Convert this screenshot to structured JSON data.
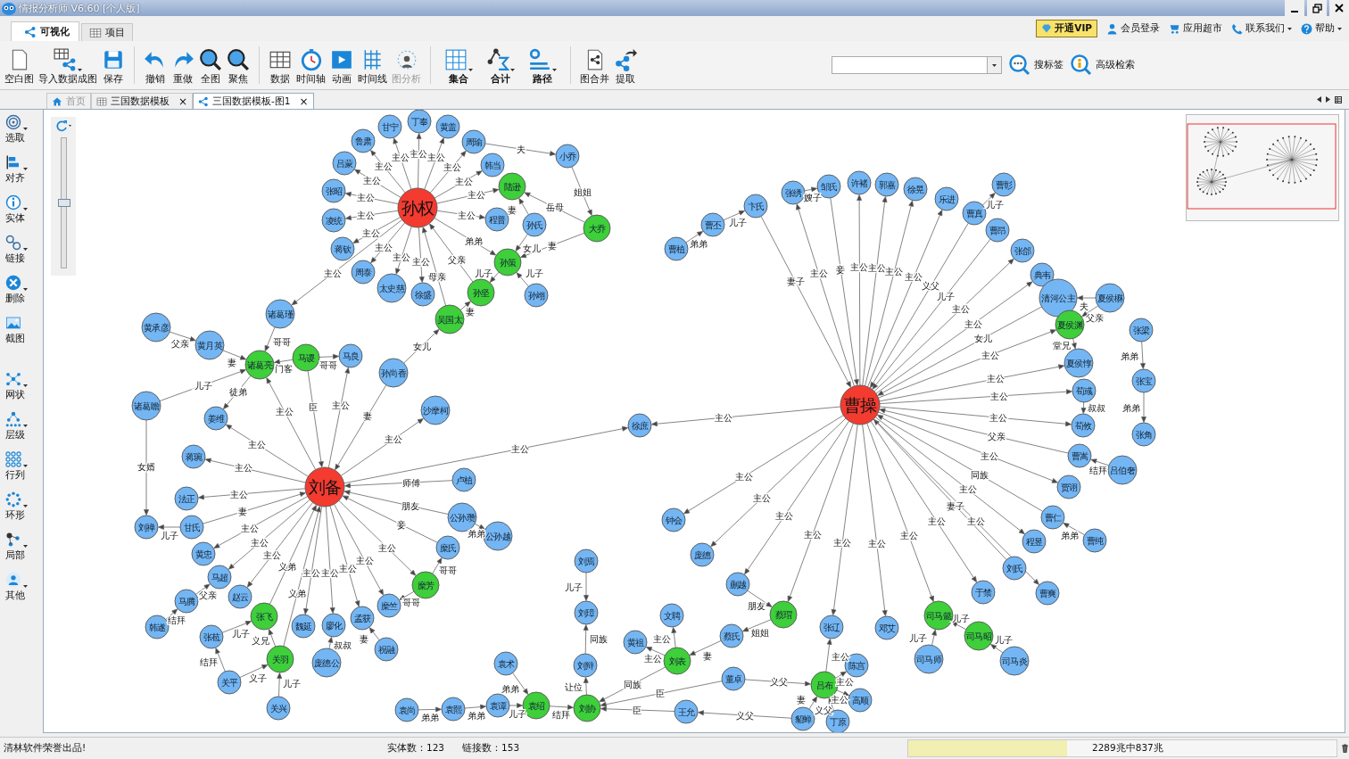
{
  "window": {
    "title": "情报分析师 V6.60 [个人版]"
  },
  "view_tabs": [
    {
      "label": "可视化",
      "selected": true
    },
    {
      "label": "项目",
      "selected": false
    }
  ],
  "header_links": [
    {
      "label": "开通VIP",
      "kind": "vip",
      "menu": false
    },
    {
      "label": "会员登录",
      "kind": "link",
      "menu": false
    },
    {
      "label": "应用超市",
      "kind": "link",
      "menu": false
    },
    {
      "label": "联系我们",
      "kind": "link",
      "menu": true
    },
    {
      "label": "帮助",
      "kind": "link",
      "menu": true
    }
  ],
  "toolbar": {
    "groups": [
      {
        "items": [
          {
            "label": "空白图",
            "disabled": false,
            "menu": false
          },
          {
            "label": "导入数据成图",
            "disabled": false,
            "menu": true
          },
          {
            "label": "保存",
            "disabled": false,
            "menu": false
          }
        ]
      },
      {
        "items": [
          {
            "label": "撤销",
            "disabled": false,
            "menu": false
          },
          {
            "label": "重做",
            "disabled": false,
            "menu": false
          },
          {
            "label": "全图",
            "disabled": false,
            "menu": false
          },
          {
            "label": "聚焦",
            "disabled": false,
            "menu": false
          }
        ]
      },
      {
        "items": [
          {
            "label": "数据",
            "disabled": false,
            "menu": false
          },
          {
            "label": "时间轴",
            "disabled": false,
            "menu": false
          },
          {
            "label": "动画",
            "disabled": false,
            "menu": false
          },
          {
            "label": "时间线",
            "disabled": false,
            "menu": false
          },
          {
            "label": "图分析",
            "disabled": true,
            "menu": false
          }
        ]
      },
      {
        "items": [
          {
            "label": "集合",
            "disabled": false,
            "menu": true
          },
          {
            "label": "合计",
            "disabled": false,
            "menu": true
          },
          {
            "label": "路径",
            "disabled": false,
            "menu": true
          }
        ]
      },
      {
        "items": [
          {
            "label": "图合并",
            "disabled": false,
            "menu": false
          },
          {
            "label": "提取",
            "disabled": false,
            "menu": false
          }
        ]
      }
    ],
    "search_buttons": [
      {
        "label": "搜标签"
      },
      {
        "label": "高级检索"
      }
    ]
  },
  "doc_tabs": [
    {
      "label": "首页",
      "selected": false,
      "disabled": true
    },
    {
      "label": "三国数据模板",
      "selected": false,
      "disabled": false,
      "close": "×"
    },
    {
      "label": "三国数据模板-图1",
      "selected": true,
      "disabled": false,
      "close": "×"
    }
  ],
  "side_tools": {
    "groups": [
      {
        "items": [
          {
            "label": "选取",
            "menu": true
          },
          {
            "label": "对齐",
            "menu": true
          },
          {
            "label": "实体",
            "menu": true
          },
          {
            "label": "链接",
            "menu": true
          },
          {
            "label": "删除",
            "menu": true
          },
          {
            "label": "截图",
            "menu": false
          }
        ]
      },
      {
        "items": [
          {
            "label": "网状",
            "menu": true
          },
          {
            "label": "层级",
            "menu": true
          },
          {
            "label": "行列",
            "menu": true
          },
          {
            "label": "环形",
            "menu": true
          },
          {
            "label": "局部",
            "menu": true
          },
          {
            "label": "其他",
            "menu": true
          }
        ]
      }
    ]
  },
  "graph": {
    "zoom_slider": {
      "level": 0.5
    },
    "nodes": [
      {
        "label": "甘宁",
        "kind": "person"
      },
      {
        "label": "丁奉",
        "kind": "person"
      },
      {
        "label": "黄盖",
        "kind": "person"
      },
      {
        "label": "鲁肃",
        "kind": "person"
      },
      {
        "label": "周瑜",
        "kind": "person"
      },
      {
        "label": "小乔",
        "kind": "person"
      },
      {
        "label": "吕蒙",
        "kind": "person"
      },
      {
        "label": "韩当",
        "kind": "person"
      },
      {
        "label": "张昭",
        "kind": "person"
      },
      {
        "label": "陆逊",
        "kind": "key"
      },
      {
        "label": "张绣",
        "kind": "person"
      },
      {
        "label": "邹氏",
        "kind": "person"
      },
      {
        "label": "许褚",
        "kind": "person"
      },
      {
        "label": "郭嘉",
        "kind": "person"
      },
      {
        "label": "徐晃",
        "kind": "person"
      },
      {
        "label": "乐进",
        "kind": "person"
      },
      {
        "label": "曹彰",
        "kind": "person"
      },
      {
        "label": "凌统",
        "kind": "person"
      },
      {
        "label": "孙权",
        "kind": "hub"
      },
      {
        "label": "程普",
        "kind": "person"
      },
      {
        "label": "卞氏",
        "kind": "person"
      },
      {
        "label": "曹真",
        "kind": "person"
      },
      {
        "label": "孙氏",
        "kind": "person"
      },
      {
        "label": "大乔",
        "kind": "key"
      },
      {
        "label": "曹丕",
        "kind": "person"
      },
      {
        "label": "曹昂",
        "kind": "person"
      },
      {
        "label": "蒋钦",
        "kind": "person"
      },
      {
        "label": "孙策",
        "kind": "key"
      },
      {
        "label": "曹植",
        "kind": "person"
      },
      {
        "label": "张郃",
        "kind": "person"
      },
      {
        "label": "周泰",
        "kind": "person"
      },
      {
        "label": "太史慈",
        "kind": "person"
      },
      {
        "label": "典韦",
        "kind": "person"
      },
      {
        "label": "徐盛",
        "kind": "person"
      },
      {
        "label": "孙坚",
        "kind": "key"
      },
      {
        "label": "孙翊",
        "kind": "person"
      },
      {
        "label": "清河公主",
        "kind": "person"
      },
      {
        "label": "夏侯楙",
        "kind": "person"
      },
      {
        "label": "黄承彦",
        "kind": "person"
      },
      {
        "label": "诸葛瑾",
        "kind": "person"
      },
      {
        "label": "吴国太",
        "kind": "key"
      },
      {
        "label": "夏侯渊",
        "kind": "key"
      },
      {
        "label": "张梁",
        "kind": "person"
      },
      {
        "label": "黄月英",
        "kind": "person"
      },
      {
        "label": "马谡",
        "kind": "key"
      },
      {
        "label": "马良",
        "kind": "person"
      },
      {
        "label": "诸葛亮",
        "kind": "key"
      },
      {
        "label": "孙尚香",
        "kind": "person"
      },
      {
        "label": "夏侯惇",
        "kind": "person"
      },
      {
        "label": "荀彧",
        "kind": "person"
      },
      {
        "label": "张宝",
        "kind": "person"
      },
      {
        "label": "诸葛瞻",
        "kind": "person"
      },
      {
        "label": "姜维",
        "kind": "person"
      },
      {
        "label": "沙摩柯",
        "kind": "person"
      },
      {
        "label": "曹操",
        "kind": "hub"
      },
      {
        "label": "徐庶",
        "kind": "person"
      },
      {
        "label": "荀攸",
        "kind": "person"
      },
      {
        "label": "张角",
        "kind": "person"
      },
      {
        "label": "蒋琬",
        "kind": "person"
      },
      {
        "label": "曹嵩",
        "kind": "person"
      },
      {
        "label": "吕伯奢",
        "kind": "person"
      },
      {
        "label": "刘备",
        "kind": "hub"
      },
      {
        "label": "卢植",
        "kind": "person"
      },
      {
        "label": "贾诩",
        "kind": "person"
      },
      {
        "label": "法正",
        "kind": "person"
      },
      {
        "label": "刘禅",
        "kind": "person"
      },
      {
        "label": "甘氏",
        "kind": "person"
      },
      {
        "label": "公孙瓒",
        "kind": "person"
      },
      {
        "label": "钟会",
        "kind": "person"
      },
      {
        "label": "曹仁",
        "kind": "person"
      },
      {
        "label": "糜氏",
        "kind": "person"
      },
      {
        "label": "公孙越",
        "kind": "person"
      },
      {
        "label": "程昱",
        "kind": "person"
      },
      {
        "label": "曹纯",
        "kind": "person"
      },
      {
        "label": "黄忠",
        "kind": "person"
      },
      {
        "label": "刘焉",
        "kind": "person"
      },
      {
        "label": "庞德",
        "kind": "person"
      },
      {
        "label": "刘氏",
        "kind": "person"
      },
      {
        "label": "马超",
        "kind": "person"
      },
      {
        "label": "糜芳",
        "kind": "key"
      },
      {
        "label": "蒯越",
        "kind": "person"
      },
      {
        "label": "于禁",
        "kind": "person"
      },
      {
        "label": "曹爽",
        "kind": "person"
      },
      {
        "label": "马腾",
        "kind": "person"
      },
      {
        "label": "赵云",
        "kind": "person"
      },
      {
        "label": "糜竺",
        "kind": "person"
      },
      {
        "label": "刘璋",
        "kind": "person"
      },
      {
        "label": "韩遂",
        "kind": "person"
      },
      {
        "label": "张飞",
        "kind": "key"
      },
      {
        "label": "魏延",
        "kind": "person"
      },
      {
        "label": "廖化",
        "kind": "person"
      },
      {
        "label": "孟获",
        "kind": "person"
      },
      {
        "label": "文聘",
        "kind": "person"
      },
      {
        "label": "蔡瑁",
        "kind": "key"
      },
      {
        "label": "张辽",
        "kind": "person"
      },
      {
        "label": "邓艾",
        "kind": "person"
      },
      {
        "label": "司马懿",
        "kind": "key"
      },
      {
        "label": "张苞",
        "kind": "person"
      },
      {
        "label": "祝融",
        "kind": "person"
      },
      {
        "label": "黄祖",
        "kind": "person"
      },
      {
        "label": "蔡氏",
        "kind": "person"
      },
      {
        "label": "司马昭",
        "kind": "key"
      },
      {
        "label": "关羽",
        "kind": "key"
      },
      {
        "label": "庞德公",
        "kind": "person"
      },
      {
        "label": "袁术",
        "kind": "person"
      },
      {
        "label": "刘辩",
        "kind": "person"
      },
      {
        "label": "刘表",
        "kind": "key"
      },
      {
        "label": "陈宫",
        "kind": "person"
      },
      {
        "label": "司马师",
        "kind": "person"
      },
      {
        "label": "司马炎",
        "kind": "person"
      },
      {
        "label": "关平",
        "kind": "person"
      },
      {
        "label": "董卓",
        "kind": "person"
      },
      {
        "label": "吕布",
        "kind": "key"
      },
      {
        "label": "关兴",
        "kind": "person"
      },
      {
        "label": "袁尚",
        "kind": "person"
      },
      {
        "label": "袁熙",
        "kind": "person"
      },
      {
        "label": "袁谭",
        "kind": "person"
      },
      {
        "label": "袁绍",
        "kind": "key"
      },
      {
        "label": "刘协",
        "kind": "key"
      },
      {
        "label": "王允",
        "kind": "person"
      },
      {
        "label": "高顺",
        "kind": "person"
      },
      {
        "label": "貂蝉",
        "kind": "person"
      },
      {
        "label": "丁原",
        "kind": "person"
      }
    ],
    "edges": [
      {
        "label": "主公"
      },
      {
        "label": "夫"
      },
      {
        "label": "主公"
      },
      {
        "label": "主公"
      },
      {
        "label": "主公"
      },
      {
        "label": "主公"
      },
      {
        "label": "主公"
      },
      {
        "label": "主公"
      },
      {
        "label": "主公"
      },
      {
        "label": "主公"
      },
      {
        "label": "姐姐"
      },
      {
        "label": "嫂子"
      },
      {
        "label": "妻"
      },
      {
        "label": "岳母"
      },
      {
        "label": "儿子"
      },
      {
        "label": "主公"
      },
      {
        "label": "主公"
      },
      {
        "label": "儿子"
      },
      {
        "label": "主公"
      },
      {
        "label": "主公"
      },
      {
        "label": "弟弟"
      },
      {
        "label": "女儿"
      },
      {
        "label": "妻"
      },
      {
        "label": "弟弟"
      },
      {
        "label": "主公"
      },
      {
        "label": "主公"
      },
      {
        "label": "父亲"
      },
      {
        "label": "主公"
      },
      {
        "label": "主公"
      },
      {
        "label": "妾"
      },
      {
        "label": "主公"
      },
      {
        "label": "主公"
      },
      {
        "label": "主公"
      },
      {
        "label": "母亲"
      },
      {
        "label": "儿子"
      },
      {
        "label": "儿子"
      },
      {
        "label": "妻子"
      },
      {
        "label": "主公"
      },
      {
        "label": "义父"
      },
      {
        "label": "儿子"
      },
      {
        "label": "妻"
      },
      {
        "label": "主公"
      },
      {
        "label": "夫"
      },
      {
        "label": "主公"
      },
      {
        "label": "父亲"
      },
      {
        "label": "父亲"
      },
      {
        "label": "哥哥"
      },
      {
        "label": "女儿"
      },
      {
        "label": "女儿"
      },
      {
        "label": "堂兄"
      },
      {
        "label": "主公"
      },
      {
        "label": "弟弟"
      },
      {
        "label": "妻"
      },
      {
        "label": "门客"
      },
      {
        "label": "哥哥"
      },
      {
        "label": "儿子"
      },
      {
        "label": "主公"
      },
      {
        "label": "徒弟"
      },
      {
        "label": "主公"
      },
      {
        "label": "主公"
      },
      {
        "label": "臣"
      },
      {
        "label": "主公"
      },
      {
        "label": "叔叔"
      },
      {
        "label": "弟弟"
      },
      {
        "label": "妻"
      },
      {
        "label": "主公"
      },
      {
        "label": "主公"
      },
      {
        "label": "主公"
      },
      {
        "label": "父亲"
      },
      {
        "label": "主公"
      },
      {
        "label": "主公"
      },
      {
        "label": "主公"
      },
      {
        "label": "女婿"
      },
      {
        "label": "主公"
      },
      {
        "label": "结拜"
      },
      {
        "label": "主公"
      },
      {
        "label": "同族"
      },
      {
        "label": "师傅"
      },
      {
        "label": "主公"
      },
      {
        "label": "主公"
      },
      {
        "label": "主公"
      },
      {
        "label": "妻"
      },
      {
        "label": "朋友"
      },
      {
        "label": "妻子"
      },
      {
        "label": "主公"
      },
      {
        "label": "主公"
      },
      {
        "label": "主公"
      },
      {
        "label": "主公"
      },
      {
        "label": "妾"
      },
      {
        "label": "儿子"
      },
      {
        "label": "弟弟"
      },
      {
        "label": "主公"
      },
      {
        "label": "主公"
      },
      {
        "label": "弟弟"
      },
      {
        "label": "主公"
      },
      {
        "label": "主公"
      },
      {
        "label": "主公"
      },
      {
        "label": "主公"
      },
      {
        "label": "主公"
      },
      {
        "label": "主公"
      },
      {
        "label": "义弟"
      },
      {
        "label": "主公"
      },
      {
        "label": "主公"
      },
      {
        "label": "主公"
      },
      {
        "label": "哥哥"
      },
      {
        "label": "义弟"
      },
      {
        "label": "儿子"
      },
      {
        "label": "父亲"
      },
      {
        "label": "哥哥"
      },
      {
        "label": "朋友"
      },
      {
        "label": "结拜"
      },
      {
        "label": "儿子"
      },
      {
        "label": "妻"
      },
      {
        "label": "姐姐"
      },
      {
        "label": "儿子"
      },
      {
        "label": "儿子"
      },
      {
        "label": "义兄"
      },
      {
        "label": "叔叔"
      },
      {
        "label": "同族"
      },
      {
        "label": "主公"
      },
      {
        "label": "妻"
      },
      {
        "label": "主公"
      },
      {
        "label": "儿子"
      },
      {
        "label": "结拜"
      },
      {
        "label": "主公"
      },
      {
        "label": "义子"
      },
      {
        "label": "儿子"
      },
      {
        "label": "同族"
      },
      {
        "label": "义父"
      },
      {
        "label": "主公"
      },
      {
        "label": "弟弟"
      },
      {
        "label": "让位"
      },
      {
        "label": "臣"
      },
      {
        "label": "妻"
      },
      {
        "label": "义父"
      },
      {
        "label": "主公"
      },
      {
        "label": "弟弟"
      },
      {
        "label": "弟弟"
      },
      {
        "label": "儿子"
      },
      {
        "label": "结拜"
      },
      {
        "label": "臣"
      },
      {
        "label": "义父"
      }
    ]
  },
  "status_bar": {
    "message": "清林软件荣誉出品!",
    "entity_count": "实体数：123",
    "link_count": "链接数：153",
    "memory": {
      "level": 0.37,
      "text": "2289兆中837兆"
    }
  }
}
